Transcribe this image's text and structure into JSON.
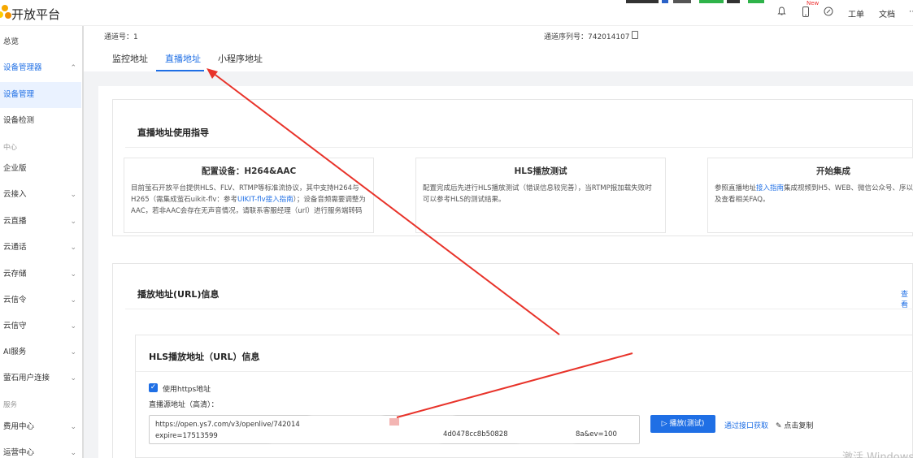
{
  "header": {
    "brand": "开放平台",
    "new_badge": "New",
    "links": [
      "工单",
      "文档"
    ],
    "icons": [
      "bell-icon",
      "phone-icon",
      "target-icon"
    ]
  },
  "sidebar": {
    "items": [
      {
        "label": "总览"
      },
      {
        "label": "设备管理器",
        "chevron": "⌃"
      },
      {
        "label": "设备管理"
      },
      {
        "label": "设备检测"
      },
      {
        "label": "中心"
      },
      {
        "label": "企业版"
      },
      {
        "label": "云接入",
        "chevron": "⌄"
      },
      {
        "label": "云直播",
        "chevron": "⌄"
      },
      {
        "label": "云通话",
        "chevron": "⌄"
      },
      {
        "label": "云存储",
        "chevron": "⌄"
      },
      {
        "label": "云信令",
        "chevron": "⌄"
      },
      {
        "label": "云信守",
        "chevron": "⌄"
      },
      {
        "label": "AI服务",
        "chevron": "⌄"
      },
      {
        "label": "萤石用户连接",
        "chevron": "⌄"
      },
      {
        "label": "服务"
      },
      {
        "label": "费用中心",
        "chevron": "⌄"
      },
      {
        "label": "运营中心",
        "chevron": "⌄"
      }
    ]
  },
  "device": {
    "channel_label": "通道号：1",
    "serial_label": "通道序列号：742014107"
  },
  "tabs": [
    "监控地址",
    "直播地址",
    "小程序地址"
  ],
  "guide": {
    "title": "直播地址使用指导",
    "boxes": [
      {
        "title": "配置设备：H264&AAC",
        "text_a": "目前萤石开放平台提供HLS、FLV、RTMP等标准流协议，其中支持H264与H265（需集成萤石uikit-flv：参考",
        "link": "UIKIT-flv接入指南",
        "text_b": "）；设备音频需要调整为AAC，若非AAC会存在无声音情况，请联系客服经理（url）进行服务端转码"
      },
      {
        "title": "HLS播放测试",
        "text_a": "配置完成后先进行HLS播放测试（错误信息较完善），当RTMP报加载失败时可以参考HLS的测试结果。",
        "link": "",
        "text_b": ""
      },
      {
        "title": "开始集成",
        "text_a": "参照直播地址",
        "link": "接入指南",
        "text_b": "集成视频到H5、WEB、微信公众号、序以及查看相关FAQ。"
      }
    ]
  },
  "url_info": {
    "title": "播放地址(URL)信息",
    "right_link": "查看"
  },
  "hls": {
    "title": "HLS播放地址（URL）信息",
    "https_label": "使用https地址",
    "source_label": "直播源地址（高清）：",
    "url_line1": "https://open.ys7.com/v3/openlive/742014",
    "url_line2": "expire=17513599",
    "url_tail": "8a&ev=100",
    "url_mid": "4d0478cc8b50828",
    "play_button": "播放(测试)",
    "api_link": "通过接口获取",
    "copy_label": "点击复制"
  },
  "watermark": "激活 Windows"
}
